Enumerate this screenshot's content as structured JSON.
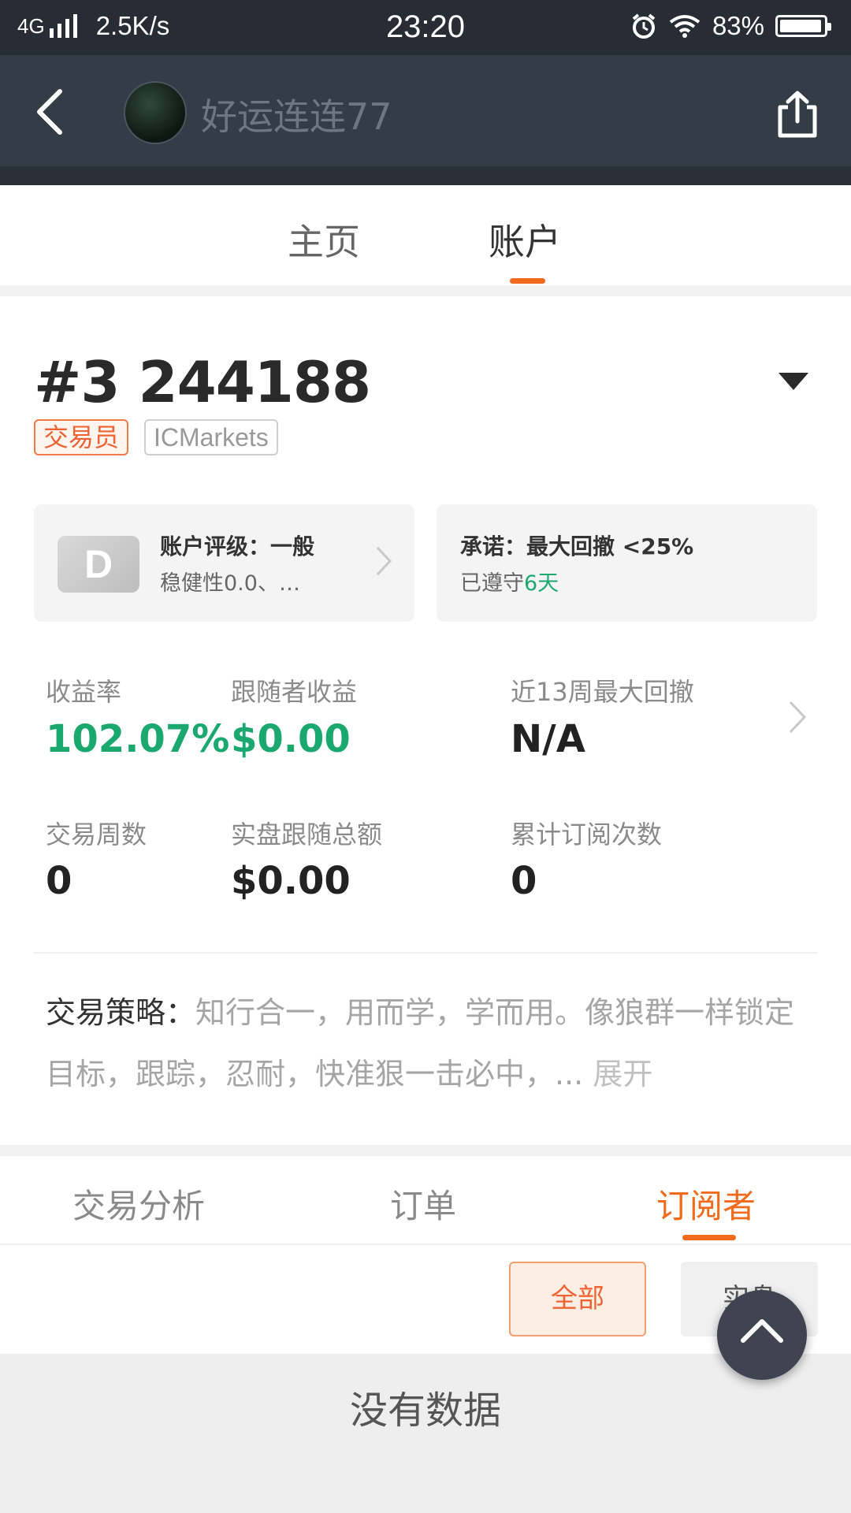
{
  "status_bar": {
    "network": "4G",
    "speed": "2.5K/s",
    "time": "23:20",
    "battery": "83%"
  },
  "header": {
    "user_name": "好运连连77"
  },
  "top_tabs": [
    {
      "label": "主页"
    },
    {
      "label": "账户"
    }
  ],
  "account": {
    "number": "#3 244188",
    "badges": [
      "交易员",
      "ICMarkets"
    ]
  },
  "cards": {
    "rating": {
      "grade": "D",
      "title": "账户评级：一般",
      "sub": "稳健性0.0、…"
    },
    "promise": {
      "title": "承诺：最大回撤 <25%",
      "sub_prefix": "已遵守",
      "sub_days": "6天"
    }
  },
  "stats": [
    {
      "label": "收益率",
      "value": "102.07%"
    },
    {
      "label": "跟随者收益",
      "value": "$0.00"
    },
    {
      "label": "近13周最大回撤",
      "value": "N/A"
    },
    {
      "label": "交易周数",
      "value": "0"
    },
    {
      "label": "实盘跟随总额",
      "value": "$0.00"
    },
    {
      "label": "累计订阅次数",
      "value": "0"
    }
  ],
  "strategy": {
    "label": "交易策略：",
    "text": "知行合一，用而学，学而用。像狼群一样锁定目标，跟踪，忍耐，快准狠一击必中，...",
    "expand": "展开"
  },
  "bottom_tabs": [
    {
      "label": "交易分析"
    },
    {
      "label": "订单"
    },
    {
      "label": "订阅者"
    }
  ],
  "filters": {
    "all": "全部",
    "live": "实盘"
  },
  "empty_text": "没有数据",
  "colors": {
    "accent": "#f26a1b",
    "green": "#1aa86e",
    "header_bg": "#343c46"
  }
}
